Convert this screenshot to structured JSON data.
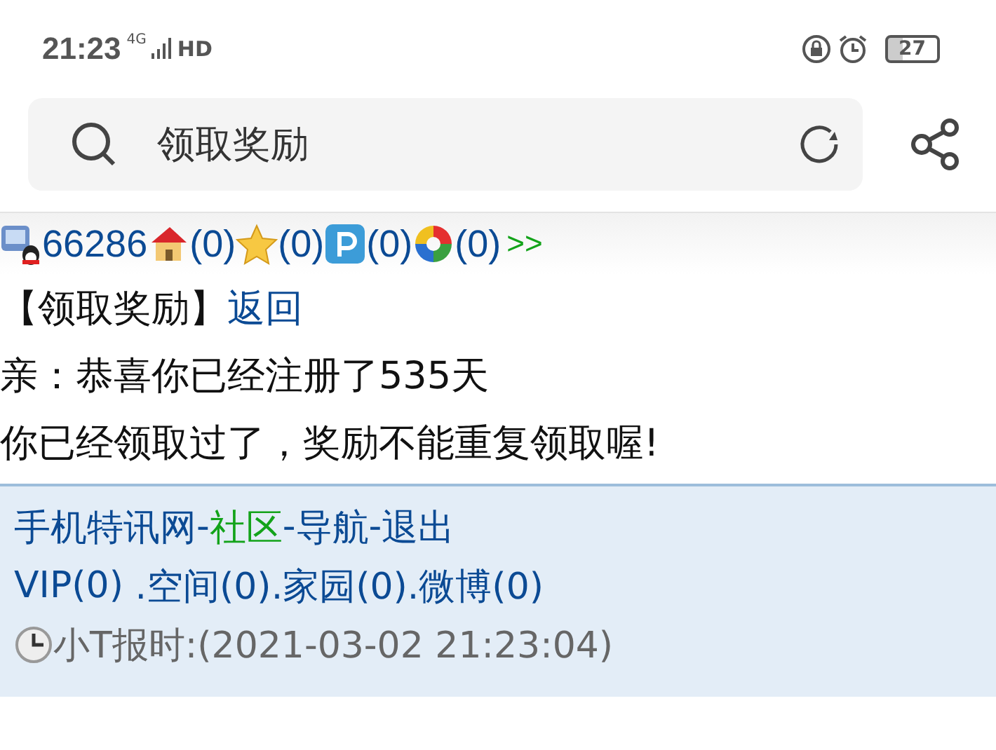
{
  "status_bar": {
    "time": "21:23",
    "network": "4G",
    "hd": "HD",
    "battery": "27"
  },
  "address_bar": {
    "title": "领取奖励"
  },
  "user_bar": {
    "user_id": "66286",
    "counters": [
      {
        "kind": "house",
        "count": "(0)"
      },
      {
        "kind": "star",
        "count": "(0)"
      },
      {
        "kind": "p",
        "count": "(0)"
      },
      {
        "kind": "swirl",
        "count": "(0)"
      }
    ],
    "more": ">>"
  },
  "heading": {
    "title": "【领取奖励】",
    "back_link": "返回"
  },
  "messages": [
    "亲：恭喜你已经注册了535天",
    "你已经领取过了，奖励不能重复领取喔!"
  ],
  "footer": {
    "nav": [
      {
        "kind": "link",
        "text": "手机特讯网",
        "color": "#0b4a94"
      },
      {
        "kind": "separator",
        "text": "-"
      },
      {
        "kind": "link",
        "text": "社区",
        "color": "#13a31a"
      },
      {
        "kind": "separator",
        "text": "-"
      },
      {
        "kind": "link",
        "text": "导航",
        "color": "#0b4a94"
      },
      {
        "kind": "separator",
        "text": "-"
      },
      {
        "kind": "link",
        "text": "退出",
        "color": "#0b4a94"
      }
    ],
    "links": [
      "VIP(0) ",
      ".空间(0)",
      ".家园(0)",
      ".微博(0)"
    ],
    "clock": "小T报时:(2021-03-02 21:23:04)"
  }
}
